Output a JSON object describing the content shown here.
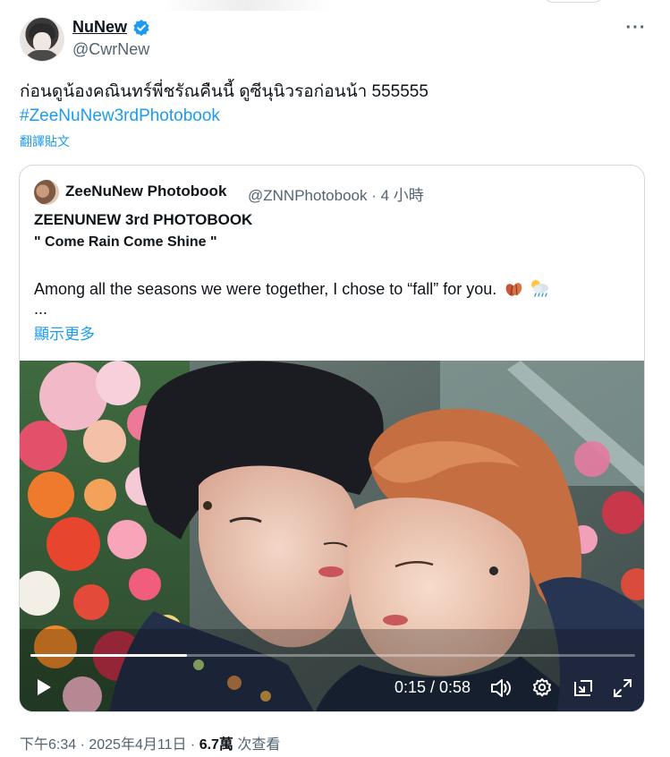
{
  "author": {
    "name": "NuNew",
    "handle": "@CwrNew"
  },
  "tweet": {
    "text": "ก่อนดูน้องคณินทร์พี่ชรัณคืนนี้ ดูซีนุนิวรอก่อนน้า 555555",
    "hashtag": "#ZeeNuNew3rdPhotobook",
    "translate_label": "翻譯貼文"
  },
  "quote": {
    "name": "ZeeNuNew Photobook",
    "handle_time": "@ZNNPhotobook · 4 小時",
    "title": "ZEENUNEW 3rd PHOTOBOOK",
    "subtitle": "\" Come Rain Come Shine \"",
    "body": "Among all the seasons we were together, I chose to “fall” for you.",
    "ellipsis": "...",
    "show_more": "顯示更多"
  },
  "video": {
    "time": "0:15 / 0:58",
    "progress": 0.259
  },
  "footer": {
    "timestamp": "下午6:34 · 2025年4月11日 · ",
    "views_count": "6.7萬",
    "views_label": " 次查看"
  },
  "colors": {
    "accent": "#1d9bf0",
    "secondary_text": "#536471",
    "border": "#cfd9de"
  },
  "icons": [
    "verified-badge-icon",
    "more-icon",
    "play-icon",
    "volume-icon",
    "settings-gear-icon",
    "picture-in-picture-icon",
    "fullscreen-icon"
  ]
}
